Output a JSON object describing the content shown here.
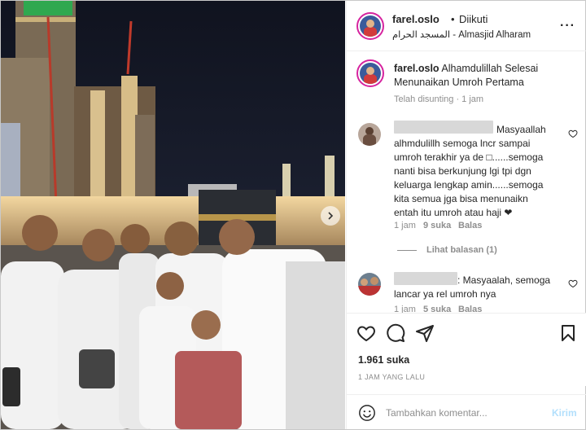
{
  "post": {
    "username": "farel.oslo",
    "dot": "•",
    "follow_status": "Diikuti",
    "location": "المسجد الحرام - Almasjid Alharam",
    "more_icon": "more-horizontal-icon"
  },
  "caption": {
    "username": "farel.oslo",
    "line1": "Alhamdulillah Selesai",
    "line2": "Menunaikan Umroh Pertama",
    "meta": "Telah disunting · 1 jam"
  },
  "comments": [
    {
      "lines": [
        "Masyaallah",
        "alhmdulillh semoga lncr sampai",
        "umroh terakhir ya de □......semoga",
        "nanti bisa berkunjung lgi tpi dgn",
        "keluarga lengkap amin......semoga",
        "kita semua jga bisa menunaikn",
        "entah itu umroh atau haji ❤"
      ],
      "time": "1 jam",
      "likes": "9 suka",
      "reply": "Balas",
      "view_replies": "Lihat balasan (1)"
    },
    {
      "lines": [
        ": Masyaalah, semoga",
        "lancar ya rel umroh nya"
      ],
      "time": "1 jam",
      "likes": "5 suka",
      "reply": "Balas"
    }
  ],
  "actions": {
    "likes": "1.961 suka",
    "time": "1 JAM YANG LALU"
  },
  "add_comment": {
    "placeholder": "Tambahkan komentar...",
    "post_label": "Kirim"
  },
  "colors": {
    "accent": "#0095f6",
    "post_disabled": "#b2dffc",
    "muted": "#8e8e8e"
  }
}
